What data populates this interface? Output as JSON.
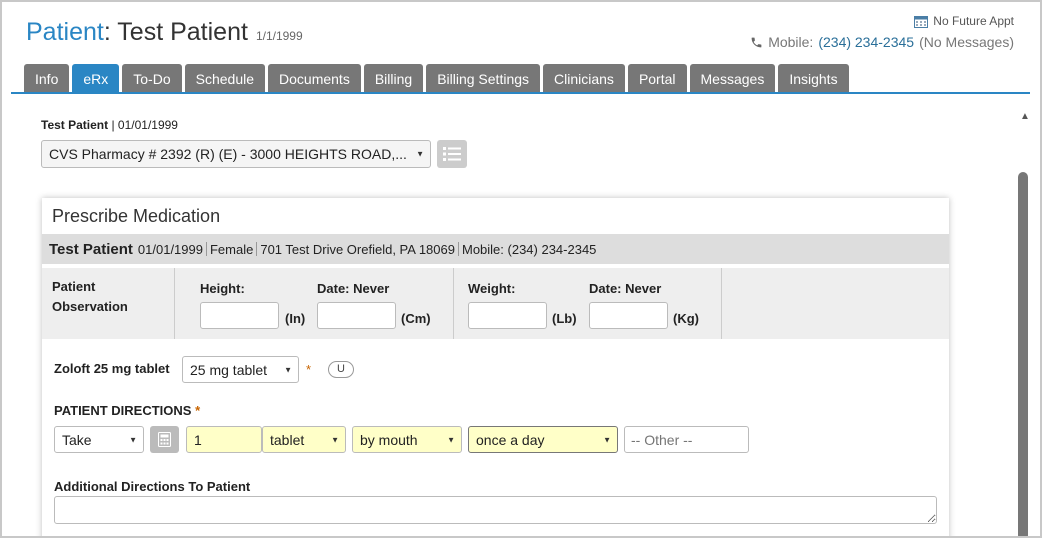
{
  "header": {
    "label": "Patient",
    "name": "Test Patient",
    "dob": "1/1/1999",
    "appointment": "No Future Appt",
    "phone_label": "Mobile:",
    "phone_number": "(234) 234-2345",
    "phone_note": "(No Messages)"
  },
  "tabs": [
    "Info",
    "eRx",
    "To-Do",
    "Schedule",
    "Documents",
    "Billing",
    "Billing Settings",
    "Clinicians",
    "Portal",
    "Messages",
    "Insights"
  ],
  "active_tab": "eRx",
  "patient_line": {
    "name": "Test Patient",
    "dob": "01/01/1999"
  },
  "pharmacy": {
    "selected": "CVS Pharmacy # 2392 (R) (E) - 3000 HEIGHTS ROAD,..."
  },
  "panel": {
    "title": "Prescribe Medication",
    "patient_bar": {
      "name": "Test Patient",
      "dob": "01/01/1999",
      "gender": "Female",
      "address": "701 Test Drive Orefield, PA 18069",
      "mobile": "Mobile: (234) 234-2345"
    },
    "observation": {
      "label_line1": "Patient",
      "label_line2": "Observation",
      "height_label": "Height:",
      "height_date": "Date: Never",
      "height_unit_in": "(In)",
      "height_unit_cm": "(Cm)",
      "weight_label": "Weight:",
      "weight_date": "Date: Never",
      "weight_unit_lb": "(Lb)",
      "weight_unit_kg": "(Kg)"
    },
    "medication": {
      "name": "Zoloft 25 mg tablet",
      "strength": "25 mg tablet",
      "required": "*",
      "badge": "U"
    },
    "directions": {
      "label": "PATIENT DIRECTIONS",
      "required": "*",
      "action": "Take",
      "quantity": "1",
      "unit": "tablet",
      "route": "by mouth",
      "frequency": "once a day",
      "other_placeholder": "-- Other --"
    },
    "additional_label": "Additional Directions To Patient"
  },
  "colors": {
    "accent": "#2a86c4",
    "tab_inactive": "#777777",
    "highlight_field": "#ffffc8"
  }
}
